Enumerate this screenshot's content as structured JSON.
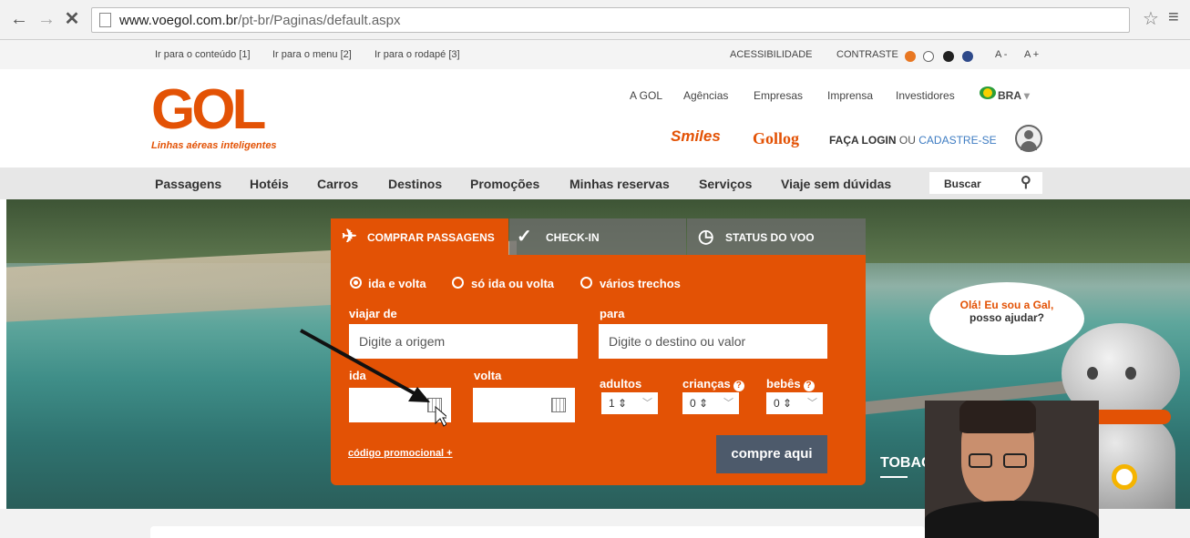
{
  "browser": {
    "url_domain": "www.voegol.com.br",
    "url_path": "/pt-br/Paginas/default.aspx"
  },
  "accessibility": {
    "skip_content": "Ir para o conteúdo [1]",
    "skip_menu": "Ir para o menu [2]",
    "skip_footer": "Ir para o rodapé [3]",
    "accessibility": "ACESSIBILIDADE",
    "contrast": "CONTRASTE",
    "font_minus": "A -",
    "font_plus": "A +",
    "contrast_colors": [
      "#e87722",
      "#ffffff",
      "#222222",
      "#2f4a8a"
    ]
  },
  "header": {
    "logo": "GOL",
    "logo_tagline": "Linhas aéreas inteligentes",
    "links": [
      "A GOL",
      "Agências",
      "Empresas",
      "Imprensa",
      "Investidores"
    ],
    "country": "BRA",
    "smiles": "Smiles",
    "gollog": "Gollog",
    "login": "FAÇA LOGIN",
    "or": "OU",
    "register": "CADASTRE-SE"
  },
  "menu": {
    "items": [
      "Passagens",
      "Hotéis",
      "Carros",
      "Destinos",
      "Promoções",
      "Minhas reservas",
      "Serviços",
      "Viaje sem dúvidas"
    ],
    "search_label": "Buscar"
  },
  "booking": {
    "tabs": [
      "COMPRAR PASSAGENS",
      "CHECK-IN",
      "STATUS DO VOO"
    ],
    "trip_types": [
      "ida e volta",
      "só ida ou volta",
      "vários trechos"
    ],
    "selected_trip_type": "ida e volta",
    "from_label": "viajar de",
    "from_placeholder": "Digite a origem",
    "to_label": "para",
    "to_placeholder": "Digite o destino ou valor",
    "depart_label": "ida",
    "return_label": "volta",
    "adults_label": "adultos",
    "children_label": "crianças",
    "babies_label": "bebês",
    "adults_value": "1",
    "children_value": "0",
    "babies_value": "0",
    "promo_code": "código promocional +",
    "submit": "compre aqui"
  },
  "hero": {
    "destination": "TOBAGO"
  },
  "chatbot": {
    "line1": "Olá! Eu sou a Gal,",
    "line2": "posso ajudar?"
  },
  "colors": {
    "brand_orange": "#e35205",
    "button_slate": "#4d5a6b"
  }
}
